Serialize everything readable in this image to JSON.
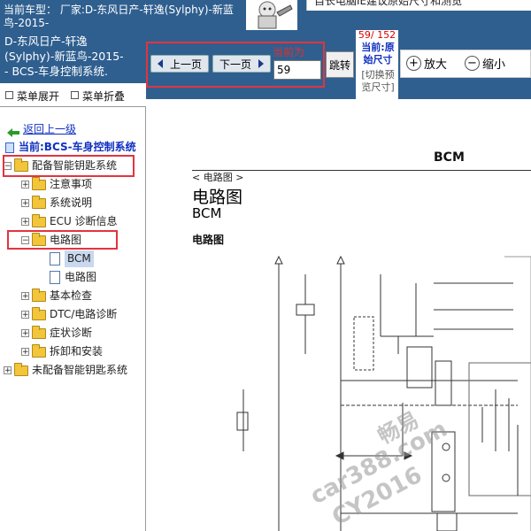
{
  "header": {
    "car_model": "当前车型： 厂家:D-东风日产-轩逸(Sylphy)-新蓝鸟-2015-",
    "notice": "自长电脑IE建议原始尺寸和测览"
  },
  "left_panel": {
    "title_lines": [
      "D-东风日产-轩逸",
      "(Sylphy)-新蓝鸟-2015-",
      "- BCS-车身控制系统."
    ],
    "menu_expand": "菜单展开",
    "menu_collapse": "菜单折叠"
  },
  "toolbar": {
    "prev_page": "上一页",
    "next_page": "下一页",
    "current_label": "当前为",
    "current_page_value": "59",
    "jump": "跳转",
    "page_count": "59/ 152",
    "size_mode_lines": [
      "当前:原",
      "始尺寸"
    ],
    "size_switch_lines": [
      "[切换预",
      "览尺寸]"
    ],
    "zoom_in": "放大",
    "zoom_out": "缩小"
  },
  "tree": {
    "back": "返回上一级",
    "current": "当前:BCS-车身控制系统",
    "items": [
      {
        "label": "配备智能钥匙系统",
        "level": 0,
        "expanded": true
      },
      {
        "label": "注意事项",
        "level": 1
      },
      {
        "label": "系统说明",
        "level": 1
      },
      {
        "label": "ECU 诊断信息",
        "level": 1
      },
      {
        "label": "电路图",
        "level": 1,
        "expanded": true
      },
      {
        "label": "BCM",
        "level": 2,
        "selected": true
      },
      {
        "label": "电路图",
        "level": 2
      },
      {
        "label": "基本检查",
        "level": 1
      },
      {
        "label": "DTC/电路诊断",
        "level": 1
      },
      {
        "label": "症状诊断",
        "level": 1
      },
      {
        "label": "拆卸和安装",
        "level": 1
      },
      {
        "label": "未配备智能钥匙系统",
        "level": 0
      }
    ]
  },
  "document": {
    "header_title": "BCM",
    "section_tag": "< 电路图 >",
    "heading": "电路图",
    "subheading": "BCM",
    "sub_section": "电路图",
    "watermark": [
      "畅易",
      "car388.com",
      "CY2016"
    ]
  },
  "colors": {
    "header_blue": "#2f5f8f",
    "highlight_red": "#e3343e",
    "link_blue": "#1030c0"
  }
}
